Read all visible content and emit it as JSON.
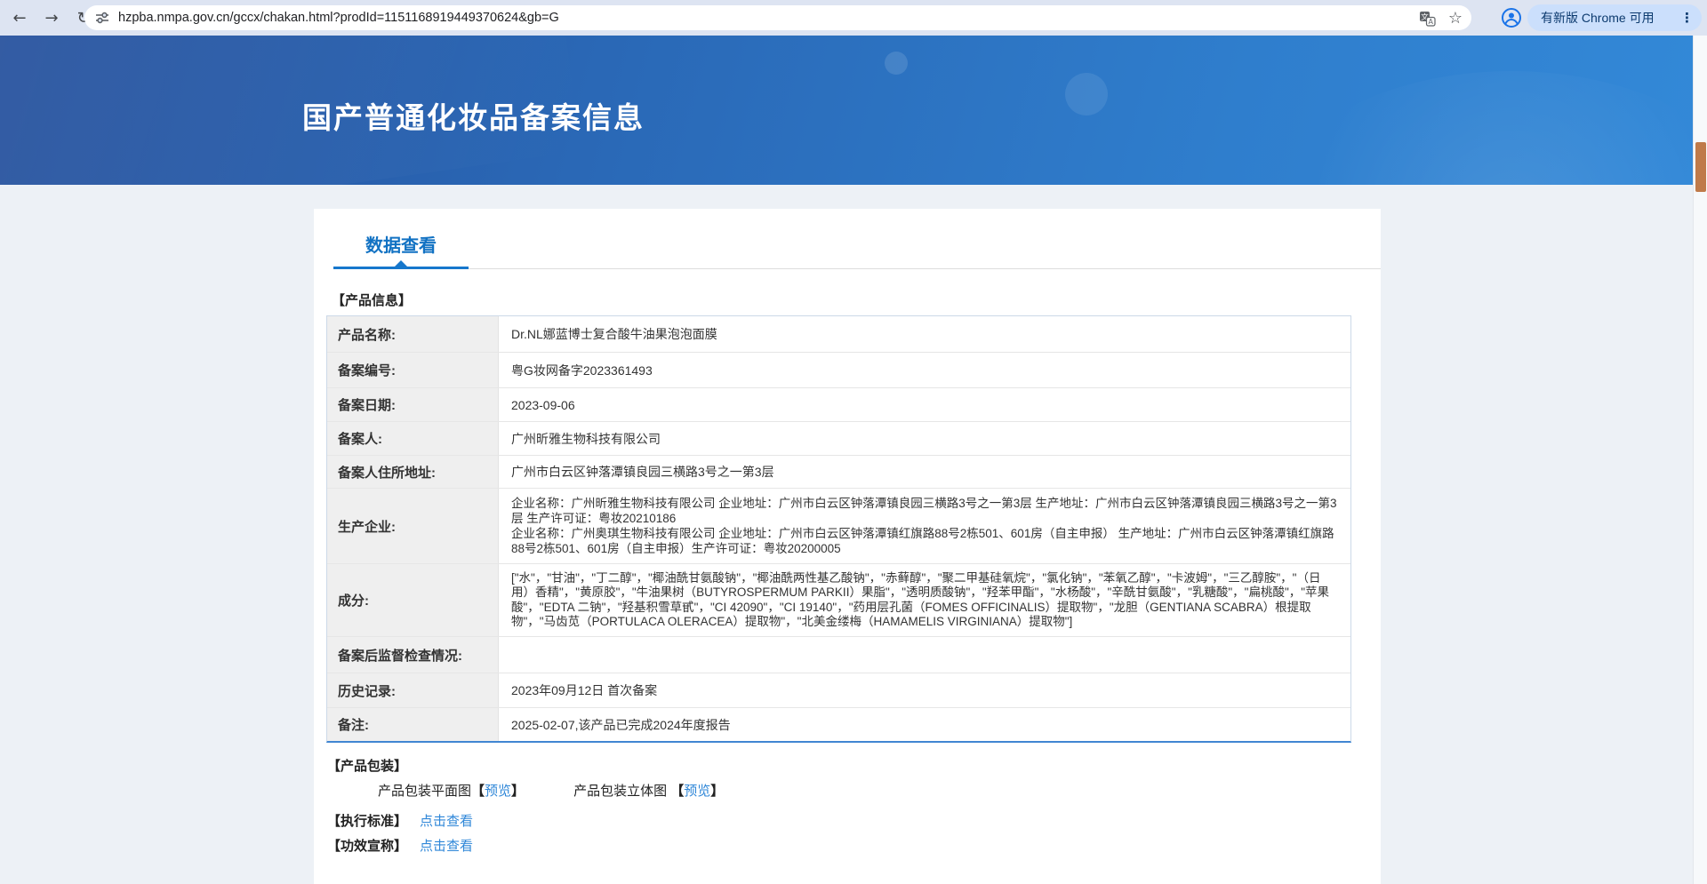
{
  "browser": {
    "url": "hzpba.nmpa.gov.cn/gccx/chakan.html?prodId=1151168919449370624&gb=G",
    "update_chip_label": "有新版 Chrome 可用",
    "menu_dots": "⋮",
    "back_glyph": "←",
    "forward_glyph": "→",
    "reload_glyph": "↻",
    "star_glyph": "☆"
  },
  "banner": {
    "title": "国产普通化妆品备案信息"
  },
  "tabs": {
    "data_view": "数据查看"
  },
  "product_info": {
    "section_title": "【产品信息】",
    "rows": [
      {
        "label": "产品名称:",
        "value": "Dr.NL娜蓝博士复合酸牛油果泡泡面膜"
      },
      {
        "label": "备案编号:",
        "value": "粤G妆网备字2023361493"
      },
      {
        "label": "备案日期:",
        "value": "2023-09-06"
      },
      {
        "label": "备案人:",
        "value": "广州昕雅生物科技有限公司"
      },
      {
        "label": "备案人住所地址:",
        "value": "广州市白云区钟落潭镇良园三横路3号之一第3层"
      },
      {
        "label": "生产企业:",
        "value": "企业名称：广州昕雅生物科技有限公司 企业地址：广州市白云区钟落潭镇良园三横路3号之一第3层 生产地址：广州市白云区钟落潭镇良园三横路3号之一第3层 生产许可证：粤妆20210186\n企业名称：广州奥琪生物科技有限公司 企业地址：广州市白云区钟落潭镇红旗路88号2栋501、601房（自主申报）  生产地址：广州市白云区钟落潭镇红旗路88号2栋501、601房（自主申报）生产许可证：粤妆20200005"
      },
      {
        "label": "成分:",
        "value": "[\"水\"，\"甘油\"，\"丁二醇\"，\"椰油酰甘氨酸钠\"，\"椰油酰两性基乙酸钠\"，\"赤藓醇\"，\"聚二甲基硅氧烷\"，\"氯化钠\"，\"苯氧乙醇\"，\"卡波姆\"，\"三乙醇胺\"，\"（日用）香精\"，\"黄原胶\"，\"牛油果树（BUTYROSPERMUM PARKII）果脂\"，\"透明质酸钠\"，\"羟苯甲酯\"，\"水杨酸\"，\"辛酰甘氨酸\"，\"乳糖酸\"，\"扁桃酸\"，\"苹果酸\"，\"EDTA 二钠\"，\"羟基积雪草甙\"，\"CI 42090\"，\"CI 19140\"，\"药用层孔菌（FOMES OFFICINALIS）提取物\"，\"龙胆（GENTIANA SCABRA）根提取物\"，\"马齿苋（PORTULACA OLERACEA）提取物\"，\"北美金缕梅（HAMAMELIS VIRGINIANA）提取物\"]"
      },
      {
        "label": "备案后监督检查情况:",
        "value": ""
      },
      {
        "label": "历史记录:",
        "value": "2023年09月12日 首次备案"
      },
      {
        "label": "备注:",
        "value": "2025-02-07,该产品已完成2024年度报告"
      }
    ]
  },
  "packaging": {
    "section_title": "【产品包装】",
    "plan_label": "产品包装平面图",
    "solid_label": "产品包装立体图",
    "bracket_open": "【",
    "bracket_close": "】",
    "preview_label": "预览"
  },
  "standards": {
    "label": "【执行标准】",
    "link_label": "点击查看"
  },
  "efficacy": {
    "label": "【功效宣称】",
    "link_label": "点击查看"
  },
  "colors": {
    "tab_accent": "#1677cc",
    "link_blue": "#2f87d8",
    "banner_blue_start": "#26519d",
    "banner_blue_end": "#3389d8",
    "scroll_thumb_orange": "#bf7a4a"
  }
}
